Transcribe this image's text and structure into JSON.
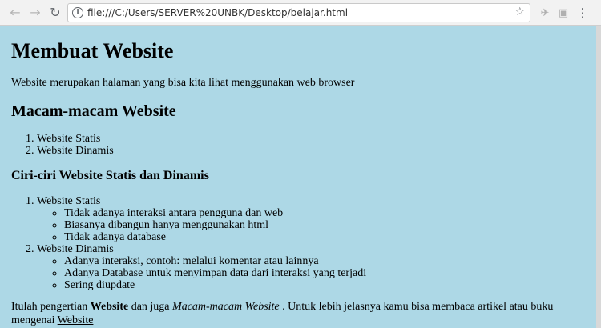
{
  "browser": {
    "url": "file:///C:/Users/SERVER%20UNBK/Desktop/belajar.html"
  },
  "page": {
    "title": "Membuat Website",
    "intro": "Website merupakan halaman yang bisa kita lihat menggunakan web browser",
    "section1_title": "Macam-macam Website",
    "types": [
      "Website Statis",
      "Website Dinamis"
    ],
    "section2_title": "Ciri-ciri Website Statis dan Dinamis",
    "static": {
      "label": "Website Statis",
      "features": [
        "Tidak adanya interaksi antara pengguna dan web",
        "Biasanya dibangun hanya menggunakan html",
        "Tidak adanya database"
      ]
    },
    "dynamic": {
      "label": "Website Dinamis",
      "features": [
        "Adanya interaksi, contoh: melalui komentar atau lainnya",
        "Adanya Database untuk menyimpan data dari interaksi yang terjadi",
        "Sering diupdate"
      ]
    },
    "closing": {
      "part1": "Itulah pengertian ",
      "bold": "Website",
      "part2": " dan juga ",
      "italic": "Macam-macam Website",
      "part3": " . Untuk lebih jelasnya kamu bisa membaca artikel atau buku mengenai ",
      "link": "Website"
    }
  }
}
